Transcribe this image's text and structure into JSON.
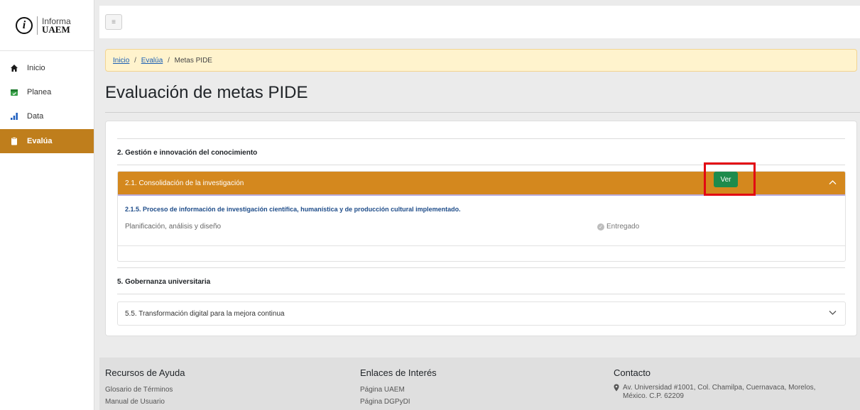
{
  "logo": {
    "line1": "Informa",
    "line2": "UAEM"
  },
  "sidebar": {
    "items": [
      {
        "label": "Inicio",
        "icon": "home-icon"
      },
      {
        "label": "Planea",
        "icon": "calendar-icon"
      },
      {
        "label": "Data",
        "icon": "bar-chart-icon"
      },
      {
        "label": "Evalúa",
        "icon": "clipboard-icon",
        "active": true
      }
    ]
  },
  "breadcrumb": {
    "home": "Inicio",
    "parent": "Evalúa",
    "current": "Metas PIDE",
    "separator": "/"
  },
  "page": {
    "title": "Evaluación de metas PIDE"
  },
  "sections": [
    {
      "title": "2. Gestión e innovación del conocimiento",
      "accordion": {
        "title": "2.1. Consolidación de la investigación",
        "goal": "2.1.5. Proceso de información de investigación científica, humanística y de producción cultural implementado.",
        "subtitle": "Planificación, análisis y diseño",
        "status": "Entregado",
        "button": "Ver"
      }
    },
    {
      "title": "5. Gobernanza universitaria",
      "accordion": {
        "title": "5.5. Transformación digital para la mejora continua"
      }
    }
  ],
  "footer": {
    "resources": {
      "title": "Recursos de Ayuda",
      "links": [
        "Glosario de Términos",
        "Manual de Usuario"
      ]
    },
    "links": {
      "title": "Enlaces de Interés",
      "links": [
        "Página UAEM",
        "Página DGPyDI"
      ]
    },
    "contact": {
      "title": "Contacto",
      "address_line1": "Av. Universidad #1001, Col. Chamilpa, Cuernavaca, Morelos,",
      "address_line2": "México. C.P. 62209"
    }
  },
  "colors": {
    "accent": "#bf7e1c",
    "accordion_header": "#d4881e",
    "button": "#1e8b4c",
    "highlight_frame": "#e30613"
  }
}
